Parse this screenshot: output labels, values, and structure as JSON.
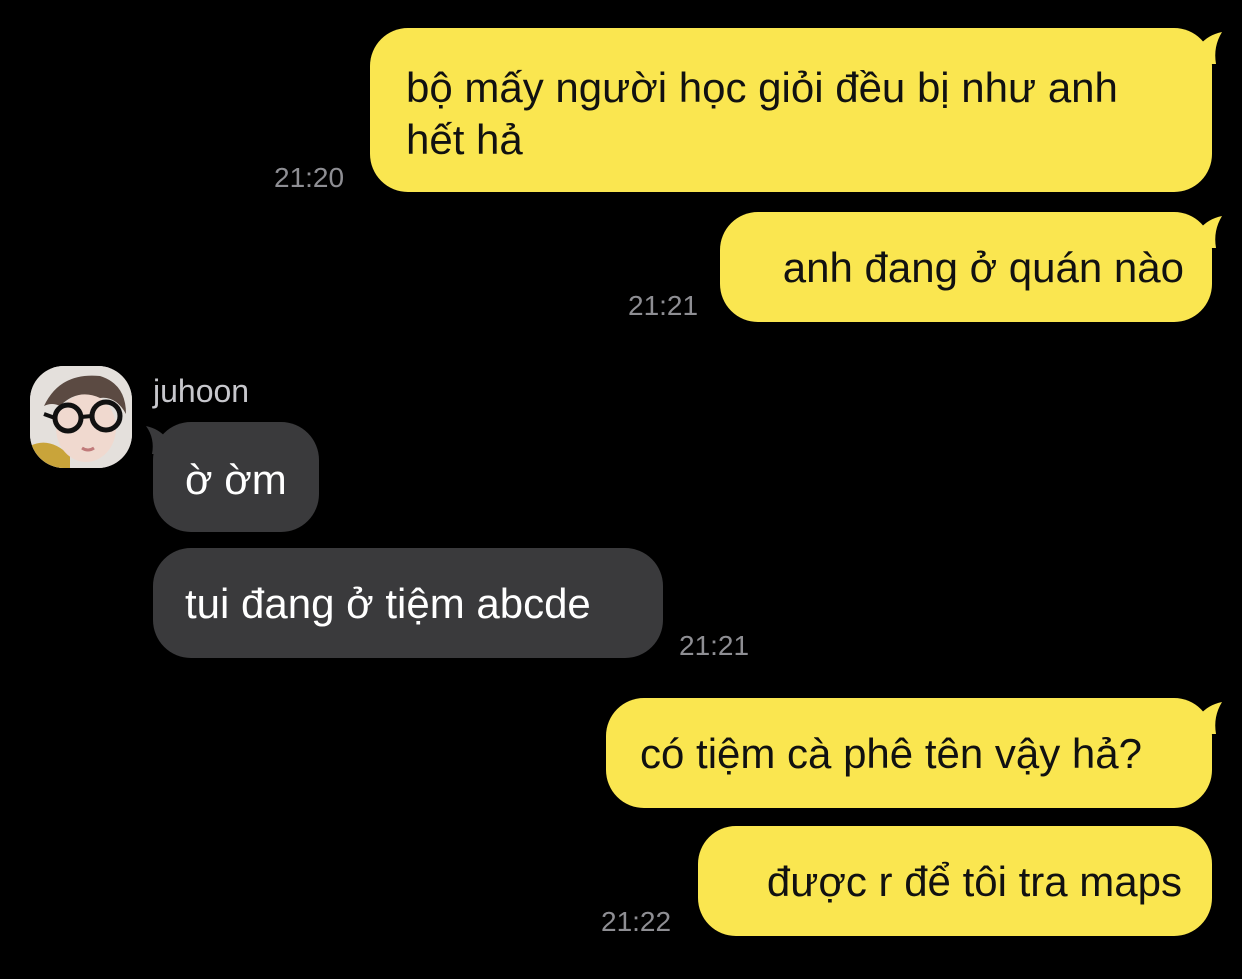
{
  "colors": {
    "background": "#000000",
    "outgoing_bubble": "#fae650",
    "incoming_bubble": "#3a3a3c",
    "timestamp": "#8e8e93"
  },
  "chat": {
    "sender_name": "juhoon",
    "messages": [
      {
        "direction": "outgoing",
        "text": "bộ mấy người học giỏi đều bị như anh\nhết hả",
        "time": "21:20"
      },
      {
        "direction": "outgoing",
        "text": "anh đang ở quán nào",
        "time": "21:21"
      },
      {
        "direction": "incoming",
        "text": "ờ ờm",
        "time": ""
      },
      {
        "direction": "incoming",
        "text": "tui đang ở tiệm abcde",
        "time": "21:21"
      },
      {
        "direction": "outgoing",
        "text": "có tiệm cà phê tên vậy hả?",
        "time": ""
      },
      {
        "direction": "outgoing",
        "text": "được r để tôi tra maps",
        "time": "21:22"
      }
    ]
  }
}
